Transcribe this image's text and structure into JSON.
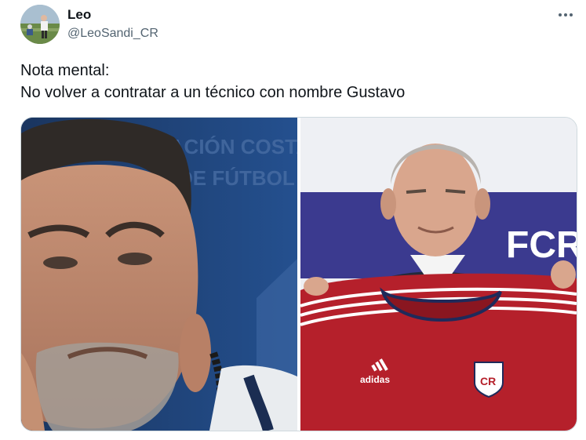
{
  "tweet": {
    "author_name": "Leo",
    "author_handle": "@LeoSandi_CR",
    "text_lines": [
      "Nota mental:",
      "No volver a contratar a un técnico con nombre Gustavo"
    ]
  },
  "icons": {
    "more": "more-horizontal-icon"
  },
  "media": {
    "left_photo_backdrop_text": [
      "RACIÓN COSTARRICE",
      "DE FÚTBOL"
    ],
    "right_photo_backdrop_text": "FCR",
    "right_photo_jersey_text": "adidas",
    "right_photo_crest_text": "CR"
  },
  "colors": {
    "text_primary": "#0f1419",
    "text_secondary": "#536471",
    "border": "#cfd9de",
    "jersey_red": "#b5202b",
    "backdrop_blue": "#1d3e72"
  }
}
